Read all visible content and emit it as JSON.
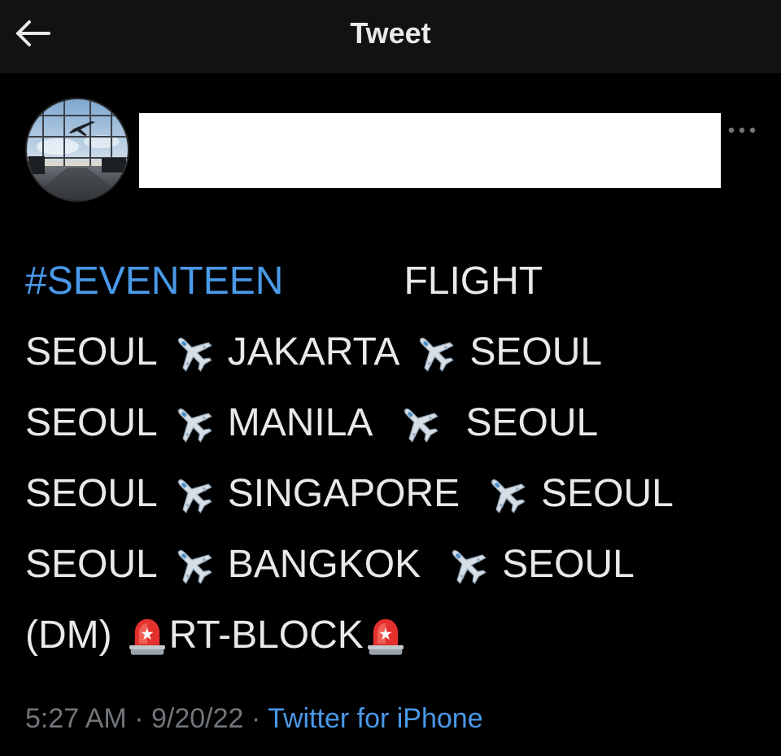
{
  "header": {
    "title": "Tweet",
    "back_icon": "arrow-left-icon",
    "more_icon": "ellipsis-icon"
  },
  "tweet": {
    "hashtag": "#SEVENTEEN",
    "heading": "FLIGHT",
    "routes": [
      {
        "origin": "SEOUL",
        "destination": "JAKARTA",
        "return": "SEOUL"
      },
      {
        "origin": "SEOUL",
        "destination": "MANILA",
        "return": "SEOUL"
      },
      {
        "origin": "SEOUL",
        "destination": "SINGAPORE",
        "return": "SEOUL"
      },
      {
        "origin": "SEOUL",
        "destination": "BANGKOK",
        "return": "SEOUL"
      }
    ],
    "dm_label": "(DM)",
    "rt_block": "RT-BLOCK",
    "route_separator_icon": "airplane-emoji-icon",
    "alert_icon": "police-light-emoji-icon"
  },
  "meta": {
    "time": "5:27 AM",
    "dot1": "·",
    "date": "9/20/22",
    "dot2": "·",
    "source": "Twitter for iPhone"
  },
  "colors": {
    "background": "#000000",
    "header_background": "#121212",
    "text": "#e7e9ea",
    "link": "#4a99e9",
    "muted": "#71767b"
  }
}
